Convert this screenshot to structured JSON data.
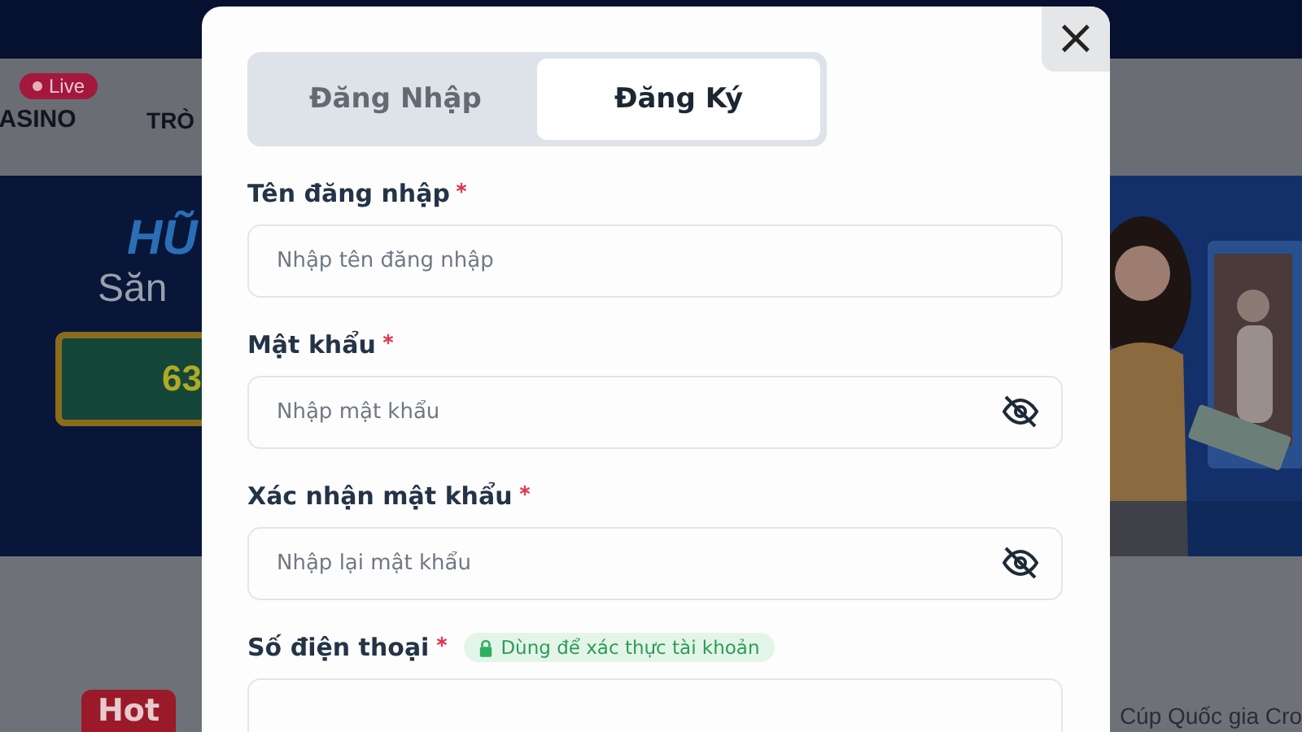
{
  "background": {
    "nav": {
      "live_badge": "Live",
      "items": [
        "ASINO",
        "TRÒ"
      ]
    },
    "banner": {
      "title": "HŨ",
      "subtitle": "Săn",
      "amount": "63"
    },
    "hot_badge": "Hot",
    "news_text": "Cúp Quốc gia Cro"
  },
  "modal": {
    "close": "×",
    "tabs": [
      {
        "label": "Đăng Nhập",
        "selected": false
      },
      {
        "label": "Đăng Ký",
        "selected": true
      }
    ],
    "fields": [
      {
        "label": "Tên đăng nhập",
        "required": true,
        "placeholder": "Nhập tên đăng nhập",
        "kind": "text"
      },
      {
        "label": "Mật khẩu",
        "required": true,
        "placeholder": "Nhập mật khẩu",
        "kind": "password"
      },
      {
        "label": "Xác nhận mật khẩu",
        "required": true,
        "placeholder": "Nhập lại mật khẩu",
        "kind": "password"
      },
      {
        "label": "Số điện thoại",
        "required": true,
        "hint": "Dùng để xác thực tài khoản",
        "kind": "phone"
      }
    ]
  }
}
